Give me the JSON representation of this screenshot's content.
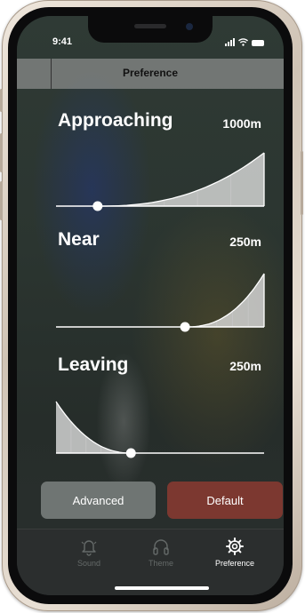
{
  "status_bar": {
    "time": "9:41"
  },
  "header": {
    "title": "Preference"
  },
  "zones": [
    {
      "label": "Approaching",
      "distance": "1000m",
      "knob_position": 0.2,
      "curve": "rising"
    },
    {
      "label": "Near",
      "distance": "250m",
      "knob_position": 0.62,
      "curve": "rising"
    },
    {
      "label": "Leaving",
      "distance": "250m",
      "knob_position": 0.36,
      "curve": "falling"
    }
  ],
  "buttons": {
    "advanced_label": "Advanced",
    "default_label": "Default"
  },
  "tabs": [
    {
      "label": "Sound",
      "icon": "bell-icon",
      "active": false
    },
    {
      "label": "Theme",
      "icon": "headphones-icon",
      "active": false
    },
    {
      "label": "Preference",
      "icon": "gear-icon",
      "active": true
    }
  ],
  "colors": {
    "default_button": "#7c3830",
    "advanced_button": "#6f7573",
    "active_tab": "#ffffff",
    "inactive_tab": "#656a69"
  }
}
